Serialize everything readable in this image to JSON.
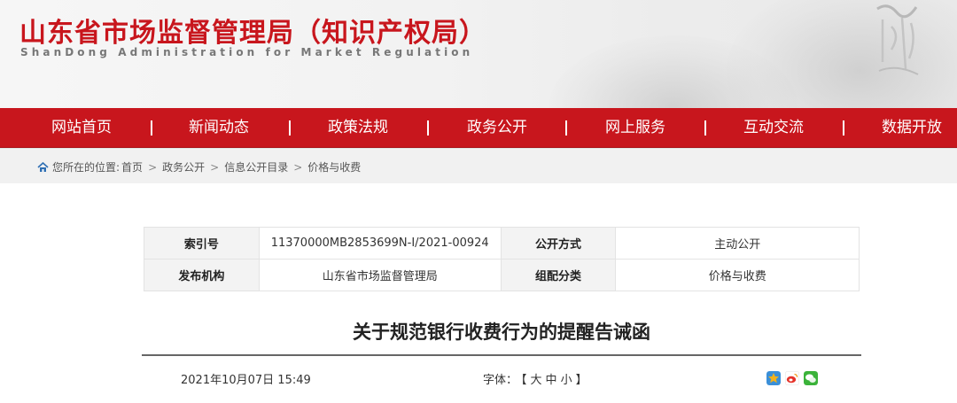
{
  "header": {
    "title_cn": "山东省市场监督管理局（知识产权局）",
    "title_en": "ShanDong Administration for Market Regulation"
  },
  "nav": {
    "items": [
      "网站首页",
      "新闻动态",
      "政策法规",
      "政务公开",
      "网上服务",
      "互动交流",
      "数据开放"
    ]
  },
  "breadcrumb": {
    "prefix": "您所在的位置:",
    "items": [
      "首页",
      "政务公开",
      "信息公开目录",
      "价格与收费"
    ],
    "separator": ">"
  },
  "meta": {
    "index_label": "索引号",
    "index_value": "11370000MB2853699N-I/2021-00924",
    "publish_mode_label": "公开方式",
    "publish_mode_value": "主动公开",
    "issuer_label": "发布机构",
    "issuer_value": "山东省市场监督管理局",
    "category_label": "组配分类",
    "category_value": "价格与收费"
  },
  "article": {
    "title": "关于规范银行收费行为的提醒告诫函",
    "date": "2021年10月07日 15:49",
    "font_label": "字体：",
    "font_open": "【",
    "font_large": "大",
    "font_medium": "中",
    "font_small": "小",
    "font_close": "】"
  },
  "share": {
    "icons": [
      "qzone-share-icon",
      "weibo-share-icon",
      "wechat-share-icon"
    ],
    "colors": [
      "#f3b21a",
      "#e5332a",
      "#3bb33a"
    ]
  },
  "colors": {
    "brand_red": "#c8161d",
    "breadcrumb_bg": "#f1f1f1"
  }
}
